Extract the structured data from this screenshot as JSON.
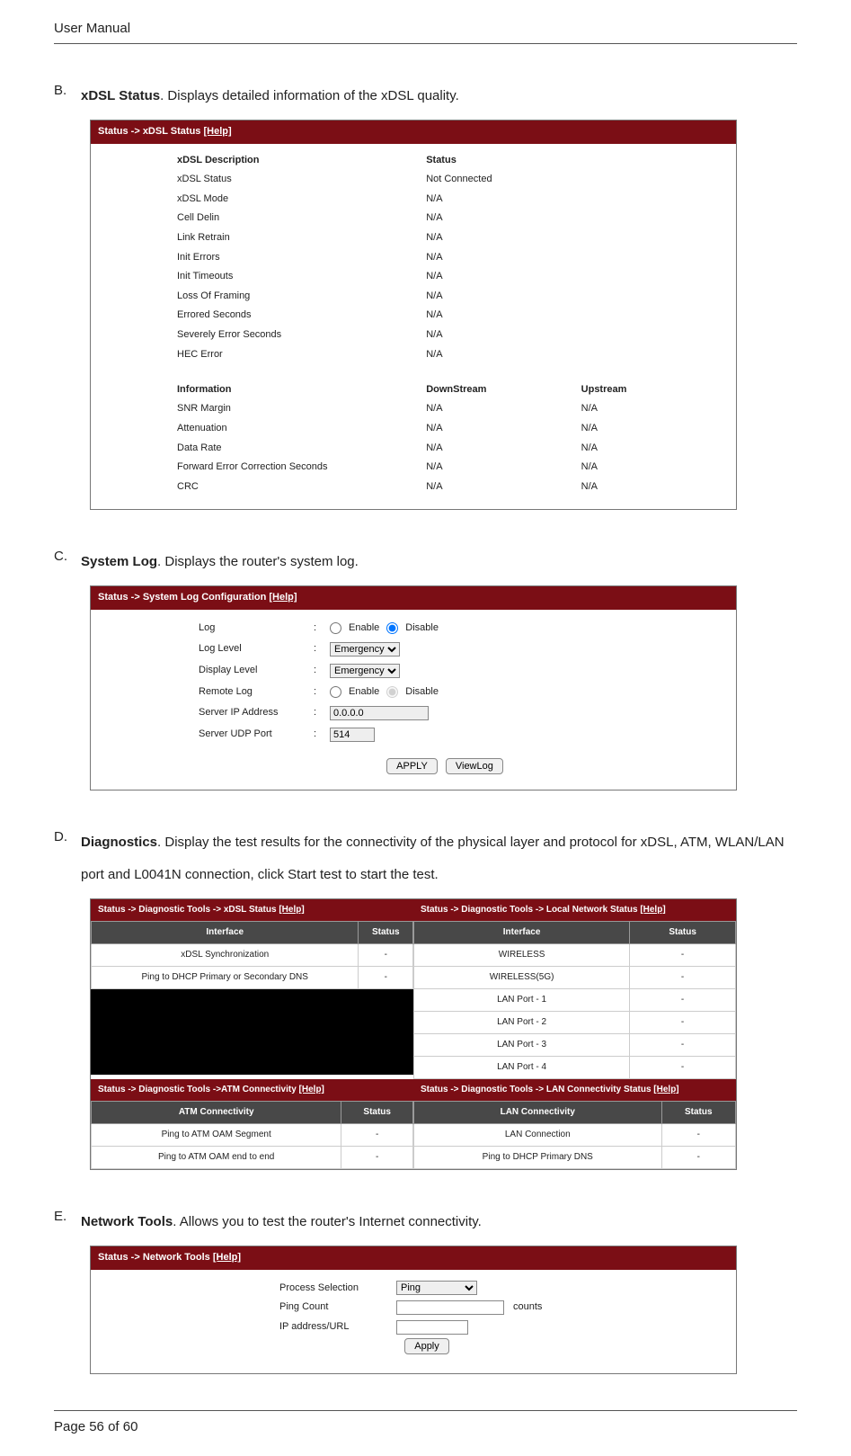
{
  "header": "User Manual",
  "footer": {
    "page_cur": "Page 56",
    "page_of": "of 60"
  },
  "secB": {
    "letter": "B.",
    "title": "xDSL Status",
    "text": ". Displays detailed information of the xDSL quality.",
    "crumb_pre": "Status -> xDSL Status ",
    "crumb_help": "[Help]",
    "hdr1a": "xDSL Description",
    "hdr1b": "Status",
    "rows1": [
      [
        "xDSL Status",
        "Not Connected"
      ],
      [
        "xDSL Mode",
        "N/A"
      ],
      [
        "Cell Delin",
        "N/A"
      ],
      [
        "Link Retrain",
        "N/A"
      ],
      [
        "Init Errors",
        "N/A"
      ],
      [
        "Init Timeouts",
        "N/A"
      ],
      [
        "Loss Of Framing",
        "N/A"
      ],
      [
        "Errored Seconds",
        "N/A"
      ],
      [
        "Severely Error Seconds",
        "N/A"
      ],
      [
        "HEC Error",
        "N/A"
      ]
    ],
    "hdr2a": "Information",
    "hdr2b": "DownStream",
    "hdr2c": "Upstream",
    "rows2": [
      [
        "SNR Margin",
        "N/A",
        "N/A"
      ],
      [
        "Attenuation",
        "N/A",
        "N/A"
      ],
      [
        "Data Rate",
        "N/A",
        "N/A"
      ],
      [
        "Forward Error Correction Seconds",
        "N/A",
        "N/A"
      ],
      [
        "CRC",
        "N/A",
        "N/A"
      ]
    ]
  },
  "secC": {
    "letter": "C.",
    "title": "System Log",
    "text": ". Displays the router's system log.",
    "crumb_pre": "Status -> System Log Configuration ",
    "crumb_help": "[Help]",
    "labels": {
      "log": "Log",
      "loglevel": "Log Level",
      "display": "Display Level",
      "remote": "Remote Log",
      "serverip": "Server IP Address",
      "serverport": "Server UDP Port"
    },
    "opt_emergency": "Emergency",
    "radio_enable": "Enable",
    "radio_disable": "Disable",
    "ip": "0.0.0.0",
    "port": "514",
    "btn_apply": "APPLY",
    "btn_view": "ViewLog"
  },
  "secD": {
    "letter": "D.",
    "title": "Diagnostics",
    "text": ". Display the test results for the connectivity of the physical layer and protocol for xDSL, ATM, WLAN/LAN port and L0041N connection, click Start test to start the test.",
    "p1_crumb_pre": "Status -> Diagnostic Tools -> xDSL Status ",
    "help": "[Help]",
    "p1_h1": "Interface",
    "p1_h2": "Status",
    "p1_rows": [
      [
        "xDSL Synchronization",
        "-"
      ],
      [
        "Ping to DHCP Primary or Secondary DNS",
        "-"
      ]
    ],
    "p2_crumb_pre": "Status -> Diagnostic Tools -> Local Network Status ",
    "p2_h1": "Interface",
    "p2_h2": "Status",
    "p2_rows": [
      [
        "WIRELESS",
        "-"
      ],
      [
        "WIRELESS(5G)",
        "-"
      ],
      [
        "LAN Port - 1",
        "-"
      ],
      [
        "LAN Port - 2",
        "-"
      ],
      [
        "LAN Port - 3",
        "-"
      ],
      [
        "LAN Port - 4",
        "-"
      ]
    ],
    "p3_crumb_pre": "Status -> Diagnostic Tools ->ATM Connectivity ",
    "p3_h1": "ATM Connectivity",
    "p3_h2": "Status",
    "p3_rows": [
      [
        "Ping to ATM OAM Segment",
        "-"
      ],
      [
        "Ping to ATM OAM end to end",
        "-"
      ]
    ],
    "p4_crumb_pre": "Status -> Diagnostic Tools -> LAN Connectivity Status ",
    "p4_h1": "LAN Connectivity",
    "p4_h2": "Status",
    "p4_rows": [
      [
        "LAN Connection",
        "-"
      ],
      [
        "Ping to DHCP Primary DNS",
        "-"
      ]
    ]
  },
  "secE": {
    "letter": "E.",
    "title": "Network Tools",
    "text": ". Allows you to test the router's Internet connectivity.",
    "crumb_pre": "Status -> Network Tools ",
    "crumb_help": "[Help]",
    "labels": {
      "proc": "Process Selection",
      "count": "Ping Count",
      "url": "IP address/URL"
    },
    "proc_opt": "Ping",
    "counts_suffix": "counts",
    "btn_apply": "Apply"
  }
}
